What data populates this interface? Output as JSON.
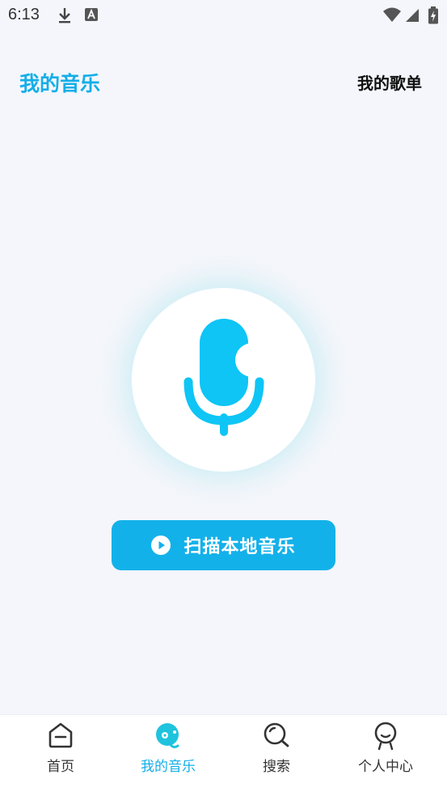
{
  "status_bar": {
    "time": "6:13",
    "icons": [
      "download-icon",
      "text-a-icon",
      "wifi-icon",
      "signal-icon",
      "battery-icon"
    ]
  },
  "header": {
    "title": "我的音乐",
    "playlist_link": "我的歌单"
  },
  "main": {
    "mic_icon": "microphone-icon",
    "scan_button_label": "扫描本地音乐",
    "scan_button_icon": "play-circle-icon"
  },
  "bottom_nav": {
    "items": [
      {
        "label": "首页",
        "icon": "home-icon",
        "active": false
      },
      {
        "label": "我的音乐",
        "icon": "music-disc-icon",
        "active": true
      },
      {
        "label": "搜索",
        "icon": "search-icon",
        "active": false
      },
      {
        "label": "个人中心",
        "icon": "person-icon",
        "active": false
      }
    ]
  },
  "colors": {
    "accent": "#14AEE8",
    "button": "#13B1EA",
    "mic": "#0EC5F5",
    "background": "#F4F6FB"
  }
}
